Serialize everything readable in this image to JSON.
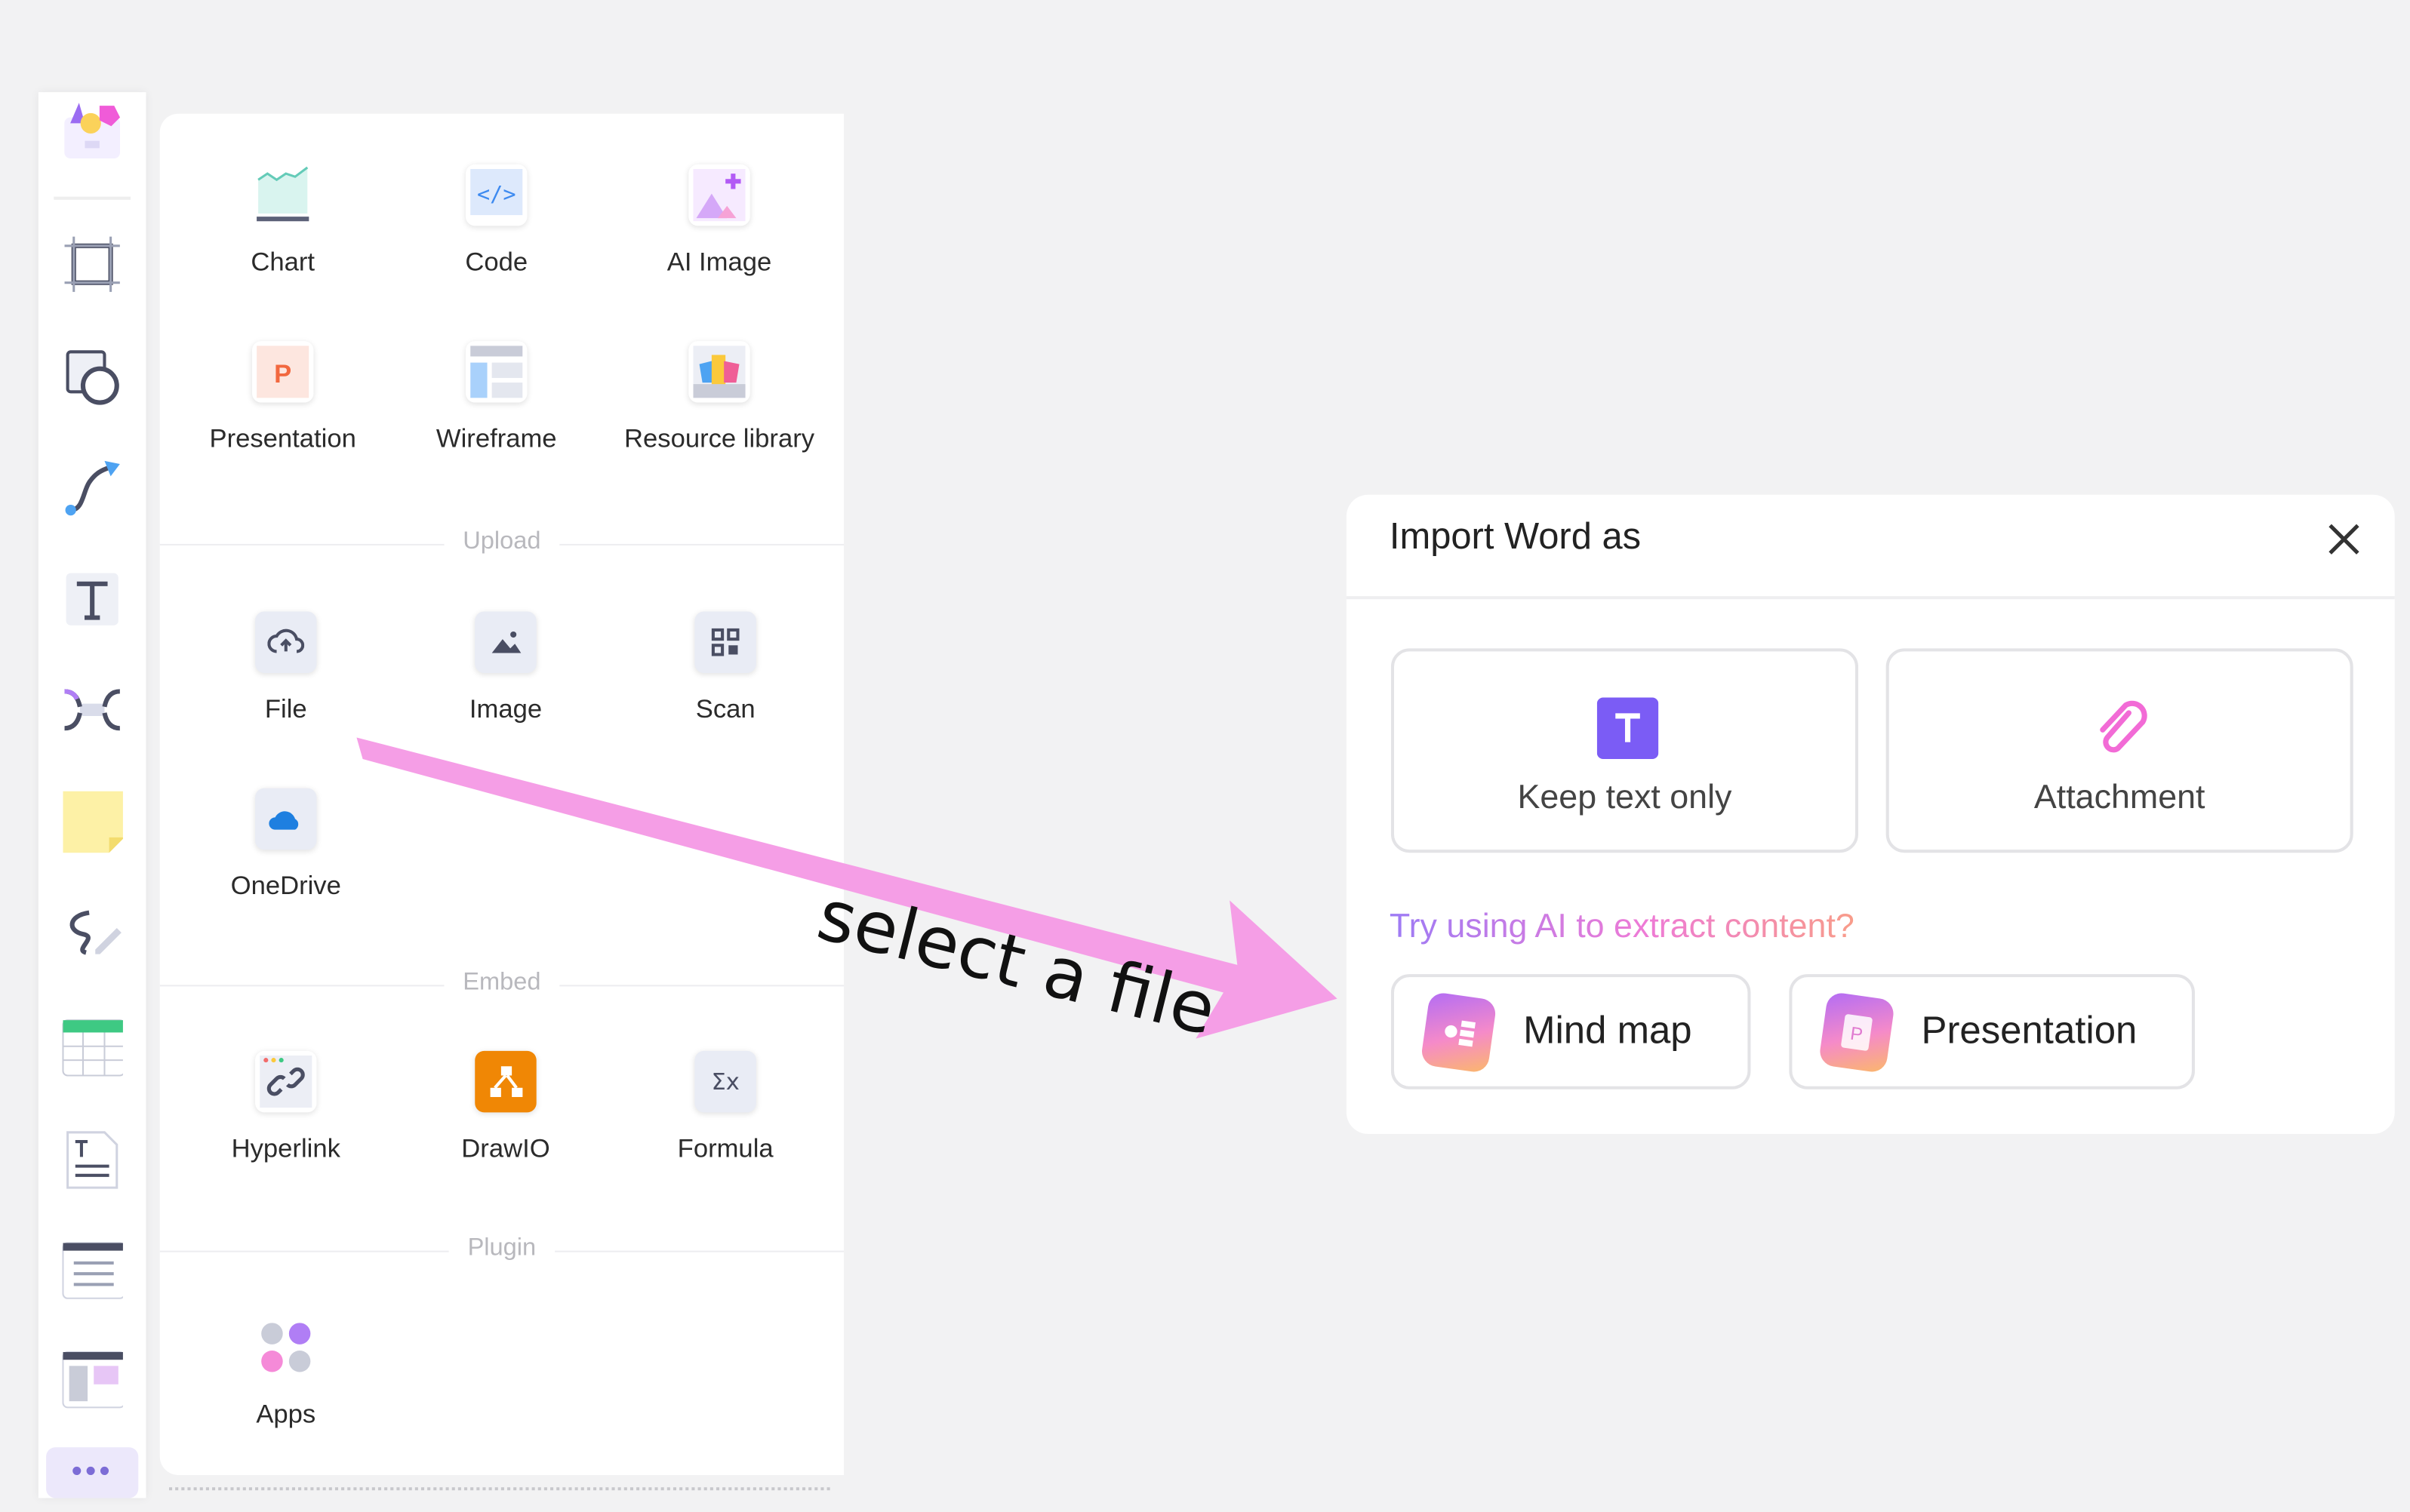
{
  "toolbar": {
    "tools": [
      "logo",
      "frame",
      "shape",
      "connector",
      "text",
      "mindmap",
      "sticky-note",
      "pen",
      "table",
      "document",
      "list",
      "template"
    ],
    "more_label": "•••"
  },
  "panel": {
    "top_items": [
      {
        "label": "Chart",
        "icon": "chart-icon"
      },
      {
        "label": "Code",
        "icon": "code-icon"
      },
      {
        "label": "AI Image",
        "icon": "ai-image-icon"
      },
      {
        "label": "Presentation",
        "icon": "presentation-icon"
      },
      {
        "label": "Wireframe",
        "icon": "wireframe-icon"
      },
      {
        "label": "Resource library",
        "icon": "resource-library-icon"
      }
    ],
    "upload": {
      "title": "Upload",
      "items": [
        {
          "label": "File"
        },
        {
          "label": "Image"
        },
        {
          "label": "Scan"
        },
        {
          "label": "OneDrive"
        }
      ]
    },
    "embed": {
      "title": "Embed",
      "items": [
        {
          "label": "Hyperlink"
        },
        {
          "label": "DrawIO"
        },
        {
          "label": "Formula"
        }
      ]
    },
    "plugin": {
      "title": "Plugin",
      "items": [
        {
          "label": "Apps"
        }
      ]
    }
  },
  "annotation": {
    "text": "select a file",
    "color": "#f59ee6"
  },
  "dialog": {
    "title": "Import Word as",
    "options": [
      {
        "label": "Keep text only",
        "icon": "text-icon"
      },
      {
        "label": "Attachment",
        "icon": "paperclip-icon"
      }
    ],
    "ai_prompt": "Try using AI to extract content?",
    "ai_options": [
      {
        "label": "Mind map",
        "icon": "mind-map-icon"
      },
      {
        "label": "Presentation",
        "icon": "presentation-icon"
      }
    ],
    "accent": "#7b5cf5"
  }
}
